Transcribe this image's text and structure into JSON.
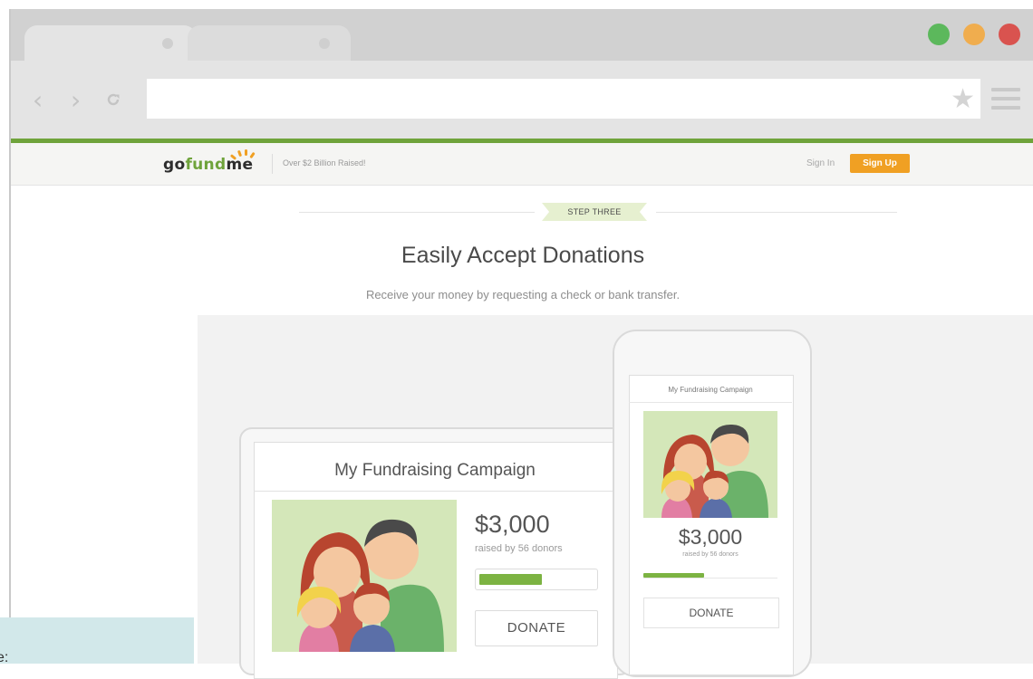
{
  "colors": {
    "traffic_green": "#5cb85c",
    "traffic_yellow": "#f0ad4e",
    "traffic_red": "#d9534f",
    "brand_green": "#6fa33b",
    "brand_orange": "#f0a023",
    "progress_green": "#7cb342"
  },
  "browser": {
    "icons": {
      "back": "chevron-left-icon",
      "forward": "chevron-right-icon",
      "reload": "reload-icon",
      "bookmark": "star-icon",
      "menu": "hamburger-menu-icon"
    },
    "address_value": ""
  },
  "site": {
    "logo_go": "go",
    "logo_fund": "fund",
    "logo_me": "me",
    "tagline": "Over $2 Billion Raised!",
    "signin": "Sign In",
    "signup": "Sign Up"
  },
  "step": {
    "label": "STEP THREE",
    "headline": "Easily Accept Donations",
    "subline": "Receive your money by requesting a check or bank transfer."
  },
  "desktop_card": {
    "title": "My Fundraising Campaign",
    "amount": "$3,000",
    "donors": "raised by 56 donors",
    "progress": 0.55,
    "donate": "DONATE"
  },
  "mobile_card": {
    "title": "My Fundraising Campaign",
    "amount": "$3,000",
    "donors": "raised by 56 donors",
    "progress": 0.45,
    "donate": "DONATE"
  },
  "caption_fragment": "e:"
}
